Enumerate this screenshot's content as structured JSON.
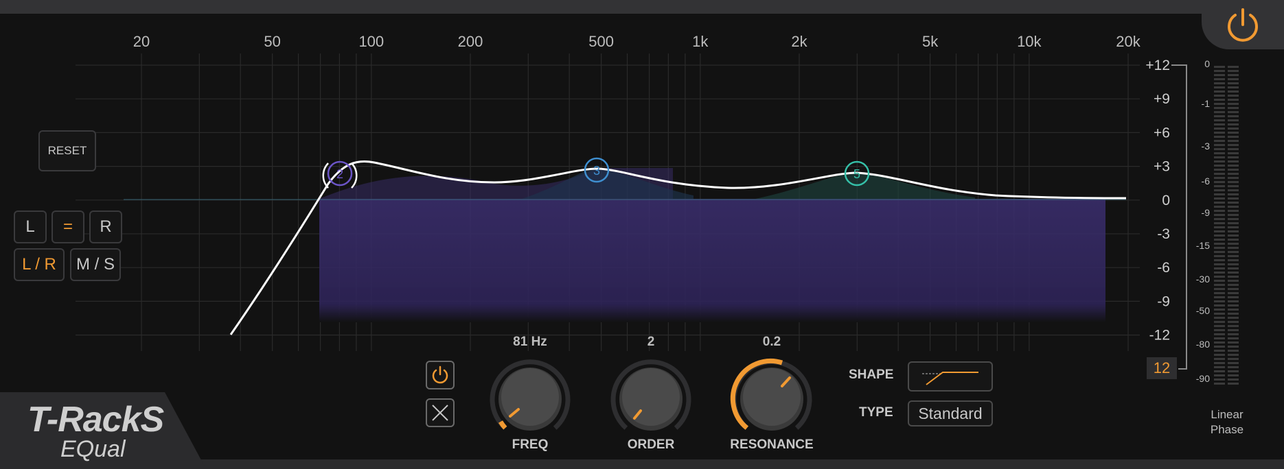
{
  "app": {
    "brand": "T-RackS",
    "product": "EQual"
  },
  "freq_axis": [
    "20",
    "50",
    "100",
    "200",
    "500",
    "1k",
    "2k",
    "5k",
    "10k",
    "20k"
  ],
  "gain_axis": [
    "+12",
    "+9",
    "+6",
    "+3",
    "0",
    "-3",
    "-6",
    "-9",
    "-12"
  ],
  "controls": {
    "reset": "RESET",
    "left": "L",
    "link": "=",
    "right": "R",
    "lr": "L / R",
    "ms": "M / S"
  },
  "bands": [
    {
      "number": "2",
      "color": "#6b55c8"
    },
    {
      "number": "3",
      "color": "#3f8fd0"
    },
    {
      "number": "5",
      "color": "#35c0a8"
    }
  ],
  "knobs": {
    "freq": {
      "label": "FREQ",
      "value": "81 Hz"
    },
    "order": {
      "label": "ORDER",
      "value": "2"
    },
    "resonance": {
      "label": "RESONANCE",
      "value": "0.2"
    }
  },
  "shape": {
    "label": "SHAPE",
    "icon": "high-pass-shape-icon"
  },
  "type": {
    "label": "TYPE",
    "value": "Standard"
  },
  "range": "12",
  "meter_scale": [
    "0",
    "-1",
    "-3",
    "-6",
    "-9",
    "-15",
    "-30",
    "-50",
    "-80",
    "-90"
  ],
  "linear_phase": {
    "line1": "Linear",
    "line2": "Phase"
  },
  "accent": "#f19a32",
  "curve_fill": "#3a2e6b"
}
